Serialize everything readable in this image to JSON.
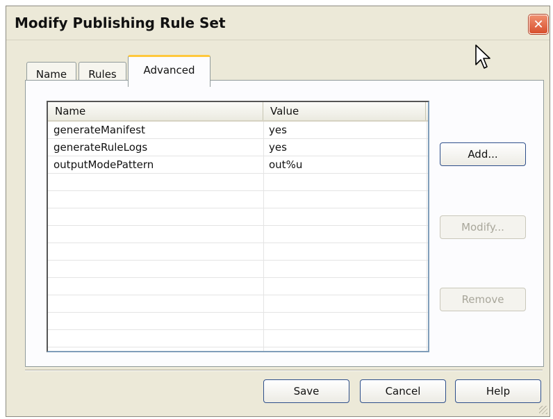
{
  "window": {
    "title": "Modify Publishing Rule Set",
    "close_glyph": "✕"
  },
  "tabs": [
    {
      "label": "Name"
    },
    {
      "label": "Rules"
    },
    {
      "label": "Advanced",
      "active": true
    }
  ],
  "list": {
    "columns": {
      "name": "Name",
      "value": "Value"
    },
    "rows": [
      {
        "name": "generateManifest",
        "value": "yes"
      },
      {
        "name": "generateRuleLogs",
        "value": "yes"
      },
      {
        "name": "outputModePattern",
        "value": "out%u"
      }
    ]
  },
  "side_buttons": {
    "add": {
      "label": "Add...",
      "enabled": true
    },
    "modify": {
      "label": "Modify...",
      "enabled": false
    },
    "remove": {
      "label": "Remove",
      "enabled": false
    }
  },
  "footer_buttons": {
    "save": "Save",
    "cancel": "Cancel",
    "help": "Help"
  },
  "icons": [
    "close-icon",
    "mouse-cursor-icon",
    "resize-grip-icon"
  ],
  "colors": {
    "window_bg": "#ece9d8",
    "active_tab_accent": "#ffc83c",
    "button_border": "#2d4e8a",
    "close_button": "#d8502e"
  }
}
